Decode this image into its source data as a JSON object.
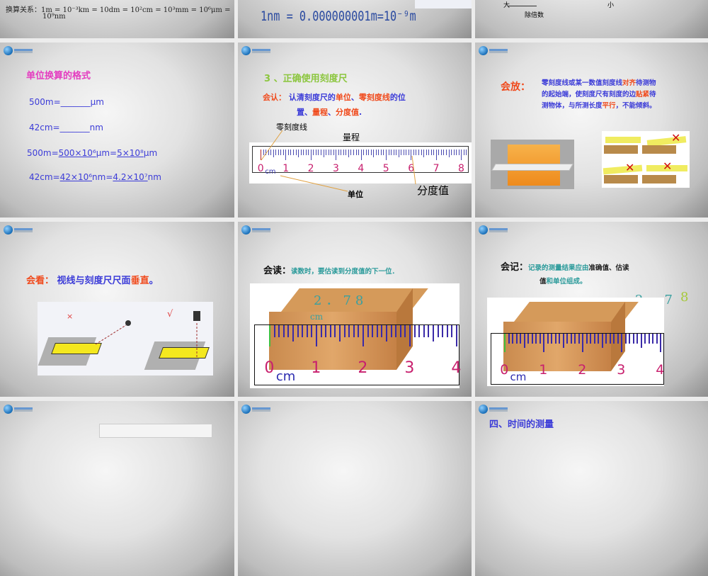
{
  "slides": [
    {
      "conversion": "换算关系：1m = 10⁻³km = 10dm = 10²cm = 10³mm = 10⁶μm =",
      "conversion2": "10⁹nm"
    },
    {
      "nm_line": "1nm = 0.000000001m=10⁻⁹m"
    },
    {
      "big": "大",
      "small": "小",
      "divide": "除倍数"
    },
    {
      "title": "单位换算的格式",
      "lines": [
        "500m=_______μm",
        "42cm=_______nm"
      ],
      "ans1": [
        "500m=",
        "500×10⁶",
        "μm=",
        "5×10⁸",
        "μm"
      ],
      "ans2": [
        "42cm=",
        "42×10⁶",
        "nm=",
        "4.2×10⁷",
        "nm"
      ]
    },
    {
      "title": "3 、正确使用刻度尺",
      "label": "会认：",
      "text_parts": [
        "认清刻度尺的",
        "单位",
        "、",
        "零刻度线",
        "的位"
      ],
      "text2_parts": [
        "置",
        "、",
        "量程",
        "、",
        "分度值",
        "."
      ],
      "zero_line": "零刻度线",
      "range": "量程",
      "unit": "单位",
      "division": "分度值",
      "ruler_numbers": [
        "0",
        "1",
        "2",
        "3",
        "4",
        "5",
        "6",
        "7",
        "8"
      ],
      "ruler_unit": "cm"
    },
    {
      "label": "会放：",
      "l1": [
        "零刻度线或某一数值刻度线",
        "对齐",
        "待测物"
      ],
      "l2": [
        "的起始端，使刻度尺有刻度的边",
        "贴紧",
        "待"
      ],
      "l3": [
        "测物体，与所测长度",
        "平行",
        "，不能倾斜。"
      ]
    },
    {
      "label": "会看：",
      "text": "视线与刻度尺尺面",
      "emph": "垂直",
      "end": "。",
      "wrong": "×",
      "right": "√"
    },
    {
      "label": "会读：",
      "text": "读数时，要估读到分度值的下一位．",
      "reading": "2．78",
      "reading_unit": "cm",
      "ruler_numbers": [
        "0",
        "1",
        "2",
        "3",
        "4"
      ],
      "ruler_unit": "cm"
    },
    {
      "label": "会记：",
      "l1": [
        "记录的测量结果应由",
        "准确值、估读"
      ],
      "l2": [
        "值",
        "和单位",
        "组成。"
      ],
      "reading_main": "2．7",
      "reading_est": "8",
      "reading_unit": "cm",
      "ruler_numbers": [
        "0",
        "1",
        "2",
        "3",
        "4"
      ],
      "ruler_unit": "cm"
    },
    {},
    {},
    {
      "title": "四、时间的测量"
    }
  ]
}
